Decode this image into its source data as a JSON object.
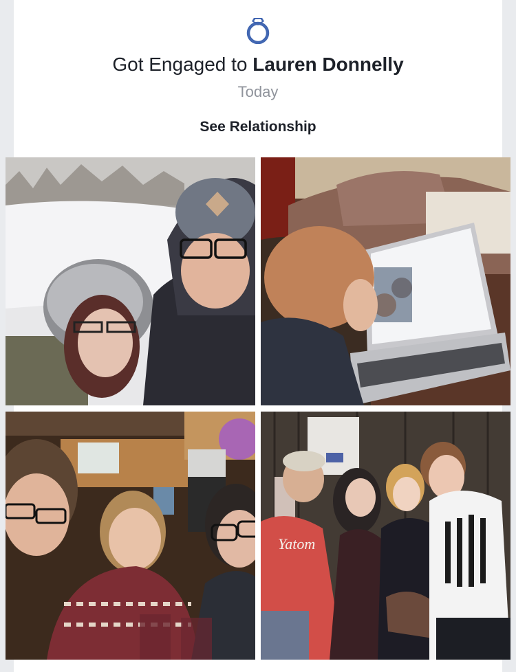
{
  "post": {
    "headline_prefix": "Got Engaged to ",
    "partner_name": "Lauren Donnelly",
    "date": "Today",
    "see_relationship_label": "See Relationship",
    "icon": "ring-icon",
    "accent_color": "#4267b2"
  },
  "photos": [
    {
      "description_icon": "photo-selfie-snow"
    },
    {
      "description_icon": "photo-child-laptop"
    },
    {
      "description_icon": "photo-pub-group"
    },
    {
      "description_icon": "photo-bar-group"
    }
  ]
}
